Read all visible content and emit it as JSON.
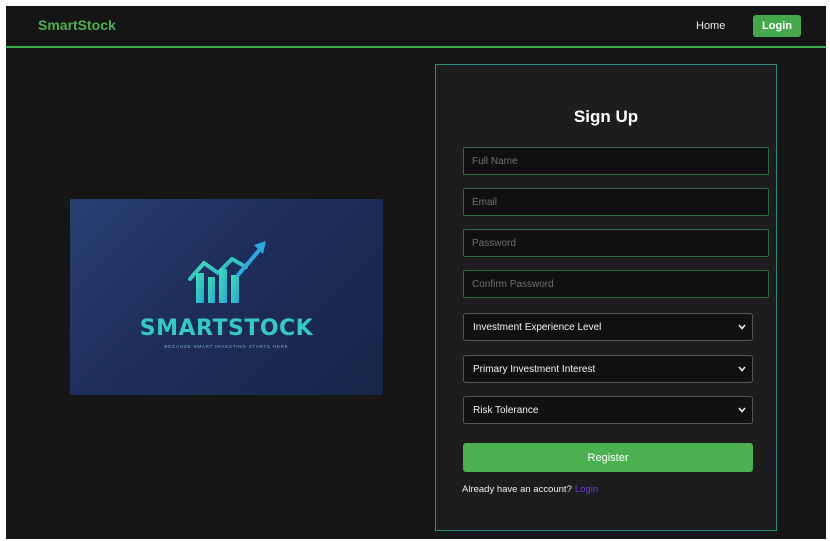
{
  "nav": {
    "brand": "SmartStock",
    "home": "Home",
    "login": "Login"
  },
  "hero": {
    "wordmark": "SMARTSTOCK",
    "tagline": "BECAUSE SMART INVESTING STARTS HERE"
  },
  "form": {
    "title": "Sign Up",
    "full_name_placeholder": "Full Name",
    "email_placeholder": "Email",
    "password_placeholder": "Password",
    "confirm_password_placeholder": "Confirm Password",
    "experience_select": "Investment Experience Level",
    "interest_select": "Primary Investment Interest",
    "risk_select": "Risk Tolerance",
    "register": "Register",
    "already_account": "Already have an account?",
    "login_link": "Login"
  },
  "colors": {
    "accent_green": "#4caf50",
    "card_border": "#2f8a80",
    "page_bg": "#161616",
    "logo_teal": "#36c8c2"
  },
  "icons": [
    "bar-chart-arrow-icon",
    "chevron-down-icon"
  ]
}
